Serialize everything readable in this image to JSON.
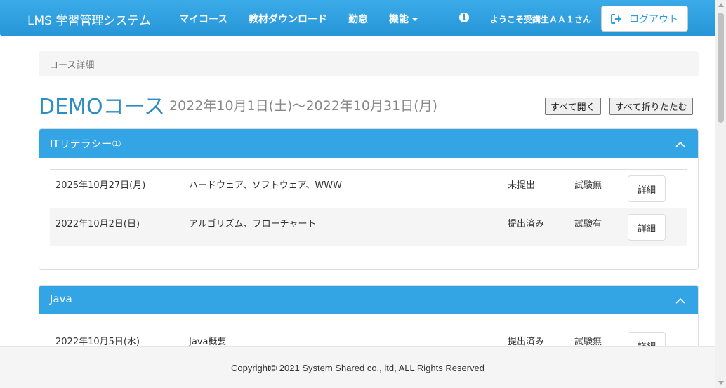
{
  "navbar": {
    "brand": "LMS 学習管理システム",
    "items": [
      {
        "label": "マイコース"
      },
      {
        "label": "教材ダウンロード"
      },
      {
        "label": "勤怠"
      },
      {
        "label": "機能"
      }
    ],
    "info_icon_glyph": "i",
    "welcome": "ようこそ受講生ＡＡ１さん",
    "logout_label": "ログアウト",
    "accent_color": "#2e9ee0"
  },
  "breadcrumb": "コース詳細",
  "course": {
    "title": "DEMOコース",
    "dates": "2022年10月1日(土)～2022年10月31日(月)",
    "expand_all": "すべて開く",
    "collapse_all": "すべて折りたたむ"
  },
  "sections": [
    {
      "title": "ITリテラシー①",
      "rows": [
        {
          "date": "2025年10月27日(月)",
          "topic": "ハードウェア、ソフトウェア、WWW",
          "submission": "未提出",
          "exam": "試験無",
          "button": "詳細"
        },
        {
          "date": "2022年10月2日(日)",
          "topic": "アルゴリズム、フローチャート",
          "submission": "提出済み",
          "exam": "試験有",
          "button": "詳細"
        }
      ]
    },
    {
      "title": "Java",
      "rows": [
        {
          "date": "2022年10月5日(水)",
          "topic": "Java概要",
          "submission": "提出済み",
          "exam": "試験無",
          "button": "詳細"
        }
      ]
    }
  ],
  "footer": "Copyright© 2021 System Shared co., ltd, ALL Rights Reserved"
}
